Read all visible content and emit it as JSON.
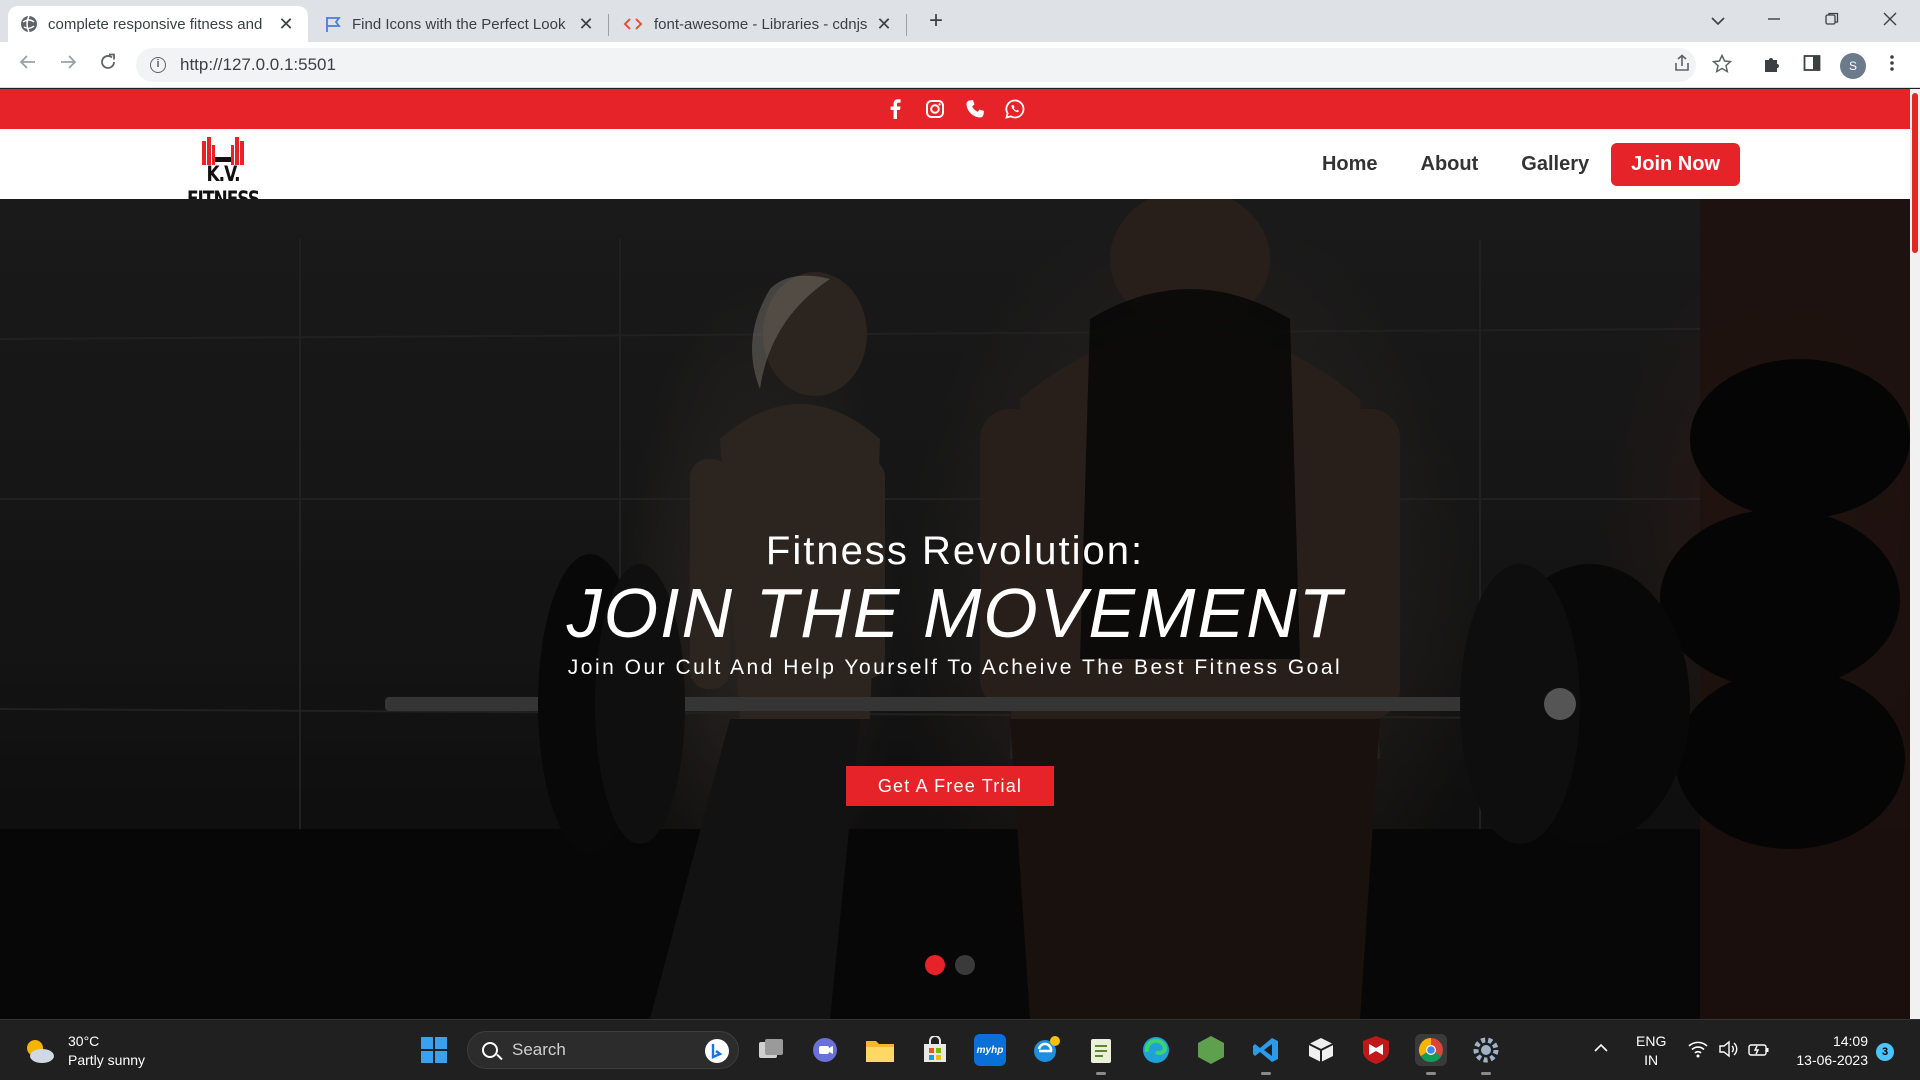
{
  "browser": {
    "tabs": [
      {
        "title": "complete responsive fitness and",
        "icon": "globe-icon",
        "active": true
      },
      {
        "title": "Find Icons with the Perfect Look",
        "icon": "flag-icon",
        "active": false
      },
      {
        "title": "font-awesome - Libraries - cdnjs",
        "icon": "code-icon",
        "active": false
      }
    ],
    "close_glyph": "✕",
    "new_tab_glyph": "+",
    "url": "http://127.0.0.1:5501",
    "profile_initial": "S"
  },
  "site": {
    "social_icons": [
      "facebook-icon",
      "instagram-icon",
      "phone-icon",
      "whatsapp-icon"
    ],
    "logo": {
      "text": "K.V. FITNESS"
    },
    "nav": {
      "home": "Home",
      "about": "About",
      "gallery": "Gallery",
      "join": "Join Now"
    },
    "hero": {
      "line1": "Fitness Revolution:",
      "line2": "JOIN THE MOVEMENT",
      "line3": "Join Our Cult And Help Yourself To Acheive The Best Fitness Goal",
      "cta": "Get A Free Trial",
      "slides_total": 2,
      "slide_active": 1
    },
    "accent_color": "#e52329"
  },
  "taskbar": {
    "weather": {
      "temp": "30°C",
      "condition": "Partly sunny"
    },
    "search_placeholder": "Search",
    "apps": [
      "windows-start-icon",
      "task-view-icon",
      "teams-chat-icon",
      "file-explorer-icon",
      "microsoft-store-icon",
      "myhp-icon",
      "internet-explorer-icon",
      "notepad-icon",
      "edge-icon",
      "node-icon",
      "vscode-icon",
      "package-icon",
      "mcafee-icon",
      "chrome-icon",
      "settings-icon"
    ],
    "myhp_label": "myhp",
    "language": {
      "line1": "ENG",
      "line2": "IN"
    },
    "clock": {
      "time": "14:09",
      "date": "13-06-2023"
    },
    "notifications": "3"
  }
}
